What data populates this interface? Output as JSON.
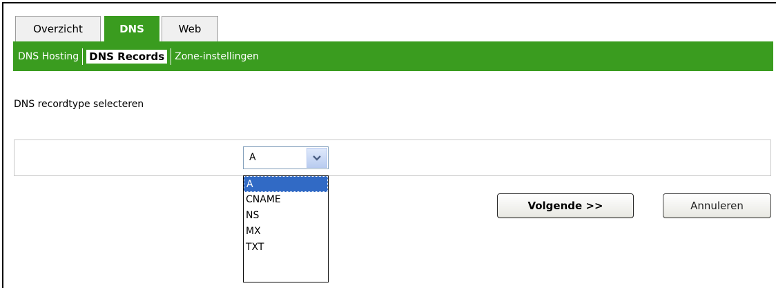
{
  "tabs": [
    {
      "label": "Overzicht",
      "active": false
    },
    {
      "label": "DNS",
      "active": true
    },
    {
      "label": "Web",
      "active": false
    }
  ],
  "subnav": {
    "items": [
      "DNS Hosting",
      "DNS Records",
      "Zone-instellingen"
    ],
    "active": "DNS Records"
  },
  "form": {
    "heading": "DNS recordtype selecteren",
    "select_value": "A",
    "options": [
      "A",
      "CNAME",
      "NS",
      "MX",
      "TXT"
    ],
    "highlighted_option": "A"
  },
  "buttons": {
    "next_label": "Volgende >>",
    "cancel_label": "Annuleren"
  },
  "colors": {
    "accent_green": "#3a9c1f",
    "selection_blue": "#316ac5"
  },
  "icons": {
    "dropdown": "chevron-down-icon"
  }
}
